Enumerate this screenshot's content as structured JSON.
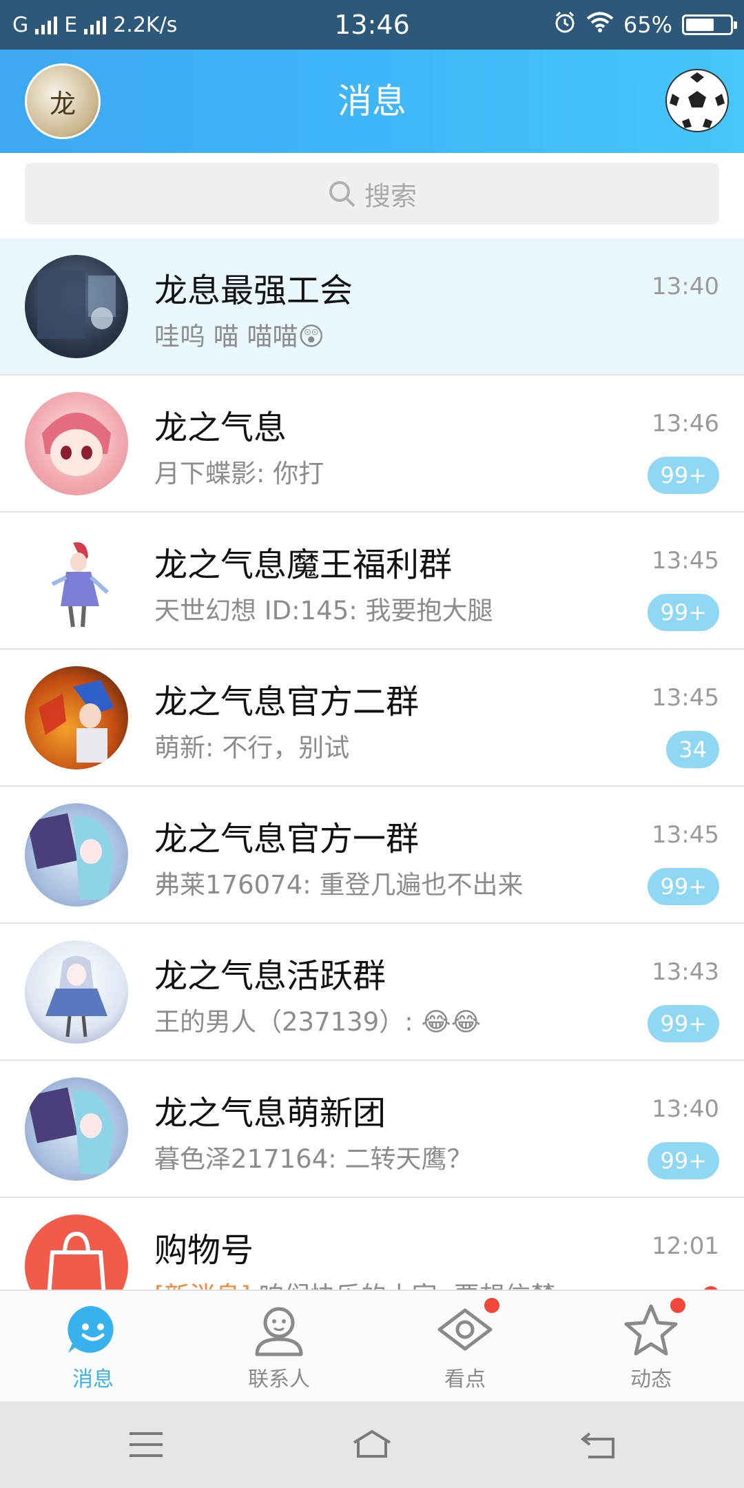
{
  "status_bar": {
    "network_left": "G",
    "network_right": "E",
    "speed": "2.2K/s",
    "time": "13:46",
    "battery": "65%",
    "battery_level": 0.65
  },
  "header": {
    "title": "消息",
    "avatar_icon": "user-avatar",
    "right_icon": "soccer-ball-icon"
  },
  "search": {
    "placeholder": "搜索"
  },
  "conversations": [
    {
      "name": "龙息最强工会",
      "message": "哇呜  喵   喵喵😲",
      "time": "13:40",
      "badge": "",
      "pinned": true
    },
    {
      "name": "龙之气息",
      "message": "月下蝶影: 你打",
      "time": "13:46",
      "badge": "99+"
    },
    {
      "name": "龙之气息魔王福利群",
      "message": "天世幻想 ID:145: 我要抱大腿",
      "time": "13:45",
      "badge": "99+"
    },
    {
      "name": "龙之气息官方二群",
      "message": "萌新: 不行，别试",
      "time": "13:45",
      "badge": "34"
    },
    {
      "name": "龙之气息官方一群",
      "message": "弗莱176074: 重登几遍也不出来",
      "time": "13:45",
      "badge": "99+"
    },
    {
      "name": "龙之气息活跃群",
      "message": "王的男人（237139）: 😂😂",
      "time": "13:43",
      "badge": "99+"
    },
    {
      "name": "龙之气息萌新团",
      "message": "暮色泽217164: 二转天鹰？",
      "time": "13:40",
      "badge": "99+"
    },
    {
      "name": "购物号",
      "tag": "[新消息]",
      "message": "咱们快乐的小家: 要想信楚…",
      "time": "12:01",
      "badge": ""
    }
  ],
  "tabs": [
    {
      "label": "消息",
      "icon": "message-bubble-icon",
      "active": true
    },
    {
      "label": "联系人",
      "icon": "contact-person-icon"
    },
    {
      "label": "看点",
      "icon": "eye-icon"
    },
    {
      "label": "动态",
      "icon": "star-icon"
    }
  ],
  "colors": {
    "accent": "#38b1ef",
    "badge": "#8fd8f3",
    "red_dot": "#f2463a",
    "status_bar": "#2e5879"
  }
}
